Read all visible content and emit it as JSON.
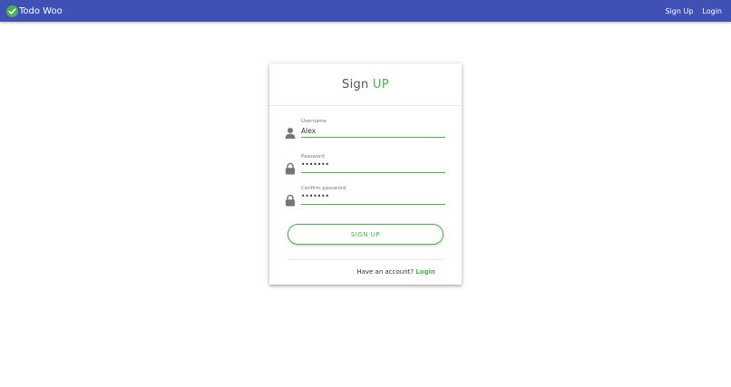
{
  "navbar": {
    "brand": "Todo Woo",
    "links": [
      "Sign Up",
      "Login"
    ]
  },
  "form": {
    "title_main": "Sign",
    "title_accent": "UP",
    "fields": [
      {
        "label": "Username",
        "value": "Alex",
        "type": "text",
        "icon": "user-icon"
      },
      {
        "label": "Password",
        "value": "•••••••",
        "type": "password",
        "icon": "lock-icon"
      },
      {
        "label": "Confirm password",
        "value": "•••••••",
        "type": "password",
        "icon": "lock-icon"
      }
    ],
    "submit_label": "SIGN UP",
    "footer_text": "Have an account?",
    "footer_link": "Login"
  },
  "colors": {
    "navbar": "#3f51b5",
    "accent": "#4caf50"
  }
}
